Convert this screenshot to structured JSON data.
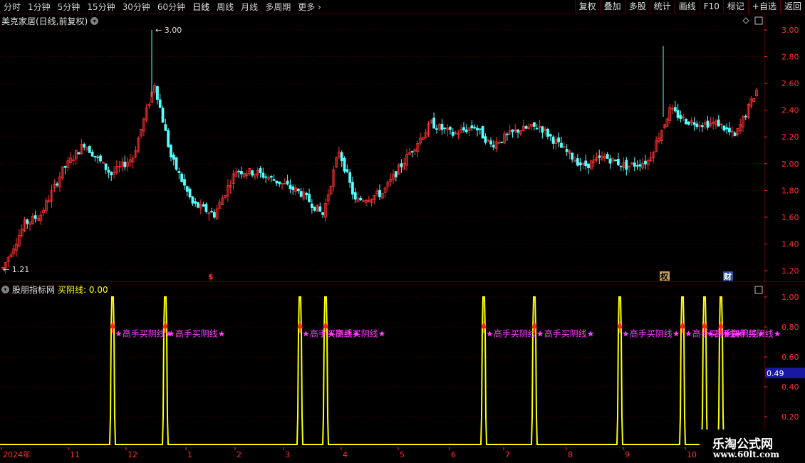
{
  "toolbar": {
    "periods": [
      "分时",
      "1分钟",
      "5分钟",
      "15分钟",
      "30分钟",
      "60分钟",
      "日线",
      "周线",
      "月线",
      "多周期",
      "更多"
    ],
    "active_period": "日线",
    "right_buttons": [
      "复权",
      "叠加",
      "多股",
      "统计",
      "画线",
      "F10",
      "标记",
      "+自选",
      "返回"
    ]
  },
  "main_chart": {
    "title": "美克家居(日线,前复权)",
    "high_label": "3.00",
    "low_label": "1.21",
    "price_ticks": [
      "3.00",
      "2.80",
      "2.60",
      "2.40",
      "2.20",
      "2.00",
      "1.80",
      "1.60",
      "1.40",
      "1.20"
    ],
    "markers": [
      {
        "text": "$"
      },
      {
        "text": "权"
      },
      {
        "text": "财"
      }
    ]
  },
  "indicator": {
    "name": "股朋指标网",
    "line_label": "买阴线: 0.00",
    "ticks": [
      "1.00",
      "0.80",
      "0.60",
      "0.40",
      "0.20"
    ],
    "current_value": "0.49",
    "signal_text": "★高手买阴线★",
    "signals": [
      1,
      1,
      1,
      1,
      1,
      1,
      1,
      1,
      1,
      1
    ]
  },
  "time_axis": [
    "2024年",
    "11",
    "12",
    "1",
    "2",
    "3",
    "4",
    "5",
    "6",
    "7",
    "8",
    "9",
    "10"
  ],
  "watermark": {
    "line1": "乐淘公式网",
    "line2": "www.60lt.com"
  },
  "colors": {
    "up": "#ff3232",
    "down": "#54ffff",
    "grid": "#5a0000",
    "indicator": "#ffff00",
    "signal": "#ff40ff",
    "axis": "#ff3030"
  }
}
